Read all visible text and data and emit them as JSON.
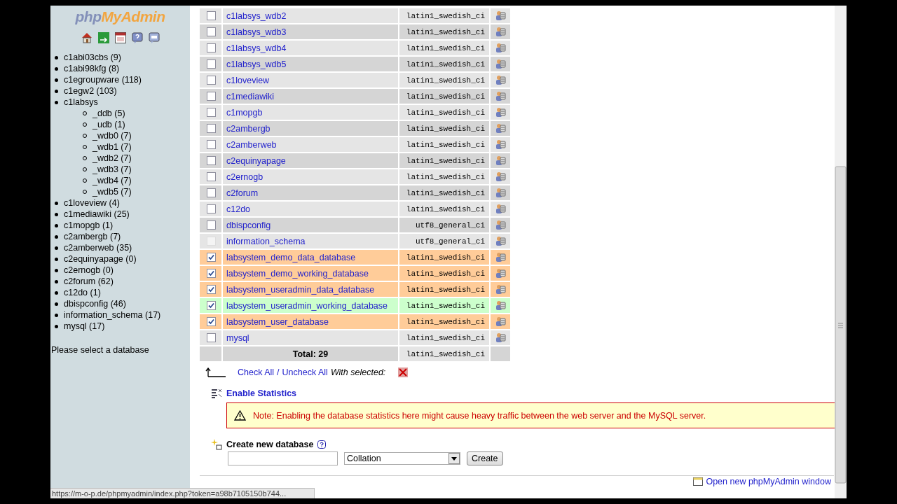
{
  "sidebar": {
    "logo": {
      "prefix": "php",
      "suffix": "MyAdmin"
    },
    "databases": [
      {
        "label": "c1abi03cbs (9)"
      },
      {
        "label": "c1abi98kfg (8)"
      },
      {
        "label": "c1egroupware (118)"
      },
      {
        "label": "c1egw2 (103)"
      },
      {
        "label": "c1labsys",
        "children": [
          {
            "label": "_ddb (5)"
          },
          {
            "label": "_udb (1)"
          },
          {
            "label": "_wdb0 (7)"
          },
          {
            "label": "_wdb1 (7)"
          },
          {
            "label": "_wdb2 (7)"
          },
          {
            "label": "_wdb3 (7)"
          },
          {
            "label": "_wdb4 (7)"
          },
          {
            "label": "_wdb5 (7)"
          }
        ]
      },
      {
        "label": "c1loveview (4)"
      },
      {
        "label": "c1mediawiki (25)"
      },
      {
        "label": "c1mopgb (1)"
      },
      {
        "label": "c2ambergb (7)"
      },
      {
        "label": "c2amberweb (35)"
      },
      {
        "label": "c2equinyapage (0)"
      },
      {
        "label": "c2ernogb (0)"
      },
      {
        "label": "c2forum (62)"
      },
      {
        "label": "c12do (1)"
      },
      {
        "label": "dbispconfig (46)"
      },
      {
        "label": "information_schema (17)"
      },
      {
        "label": "mysql (17)"
      }
    ],
    "hint": "Please select a database"
  },
  "table": {
    "rows": [
      {
        "name": "c1labsys_wdb2",
        "collation": "latin1_swedish_ci",
        "checked": false,
        "hovered": false,
        "disabled": false
      },
      {
        "name": "c1labsys_wdb3",
        "collation": "latin1_swedish_ci",
        "checked": false,
        "hovered": false,
        "disabled": false
      },
      {
        "name": "c1labsys_wdb4",
        "collation": "latin1_swedish_ci",
        "checked": false,
        "hovered": false,
        "disabled": false
      },
      {
        "name": "c1labsys_wdb5",
        "collation": "latin1_swedish_ci",
        "checked": false,
        "hovered": false,
        "disabled": false
      },
      {
        "name": "c1loveview",
        "collation": "latin1_swedish_ci",
        "checked": false,
        "hovered": false,
        "disabled": false
      },
      {
        "name": "c1mediawiki",
        "collation": "latin1_swedish_ci",
        "checked": false,
        "hovered": false,
        "disabled": false
      },
      {
        "name": "c1mopgb",
        "collation": "latin1_swedish_ci",
        "checked": false,
        "hovered": false,
        "disabled": false
      },
      {
        "name": "c2ambergb",
        "collation": "latin1_swedish_ci",
        "checked": false,
        "hovered": false,
        "disabled": false
      },
      {
        "name": "c2amberweb",
        "collation": "latin1_swedish_ci",
        "checked": false,
        "hovered": false,
        "disabled": false
      },
      {
        "name": "c2equinyapage",
        "collation": "latin1_swedish_ci",
        "checked": false,
        "hovered": false,
        "disabled": false
      },
      {
        "name": "c2ernogb",
        "collation": "latin1_swedish_ci",
        "checked": false,
        "hovered": false,
        "disabled": false
      },
      {
        "name": "c2forum",
        "collation": "latin1_swedish_ci",
        "checked": false,
        "hovered": false,
        "disabled": false
      },
      {
        "name": "c12do",
        "collation": "latin1_swedish_ci",
        "checked": false,
        "hovered": false,
        "disabled": false
      },
      {
        "name": "dbispconfig",
        "collation": "utf8_general_ci",
        "checked": false,
        "hovered": false,
        "disabled": false
      },
      {
        "name": "information_schema",
        "collation": "utf8_general_ci",
        "checked": false,
        "hovered": false,
        "disabled": true
      },
      {
        "name": "labsystem_demo_data_database",
        "collation": "latin1_swedish_ci",
        "checked": true,
        "hovered": false,
        "disabled": false
      },
      {
        "name": "labsystem_demo_working_database",
        "collation": "latin1_swedish_ci",
        "checked": true,
        "hovered": false,
        "disabled": false
      },
      {
        "name": "labsystem_useradmin_data_database",
        "collation": "latin1_swedish_ci",
        "checked": true,
        "hovered": false,
        "disabled": false
      },
      {
        "name": "labsystem_useradmin_working_database",
        "collation": "latin1_swedish_ci",
        "checked": true,
        "hovered": true,
        "disabled": false
      },
      {
        "name": "labsystem_user_database",
        "collation": "latin1_swedish_ci",
        "checked": true,
        "hovered": false,
        "disabled": false
      },
      {
        "name": "mysql",
        "collation": "latin1_swedish_ci",
        "checked": false,
        "hovered": false,
        "disabled": false
      }
    ],
    "total": {
      "label": "Total: 29",
      "collation": "latin1_swedish_ci"
    }
  },
  "bulk": {
    "check_all": "Check All",
    "separator": "/",
    "uncheck_all": "Uncheck All",
    "with_selected": "With selected:"
  },
  "statistics": {
    "link": "Enable Statistics",
    "note": "Note: Enabling the database statistics here might cause heavy traffic between the web server and the MySQL server."
  },
  "create": {
    "title": "Create new database",
    "collation_placeholder": "Collation",
    "button": "Create"
  },
  "footer_link": "Open new phpMyAdmin window",
  "status_bar": "https://m-o-p.de/phpmyadmin/index.php?token=a98b7105150b744..."
}
